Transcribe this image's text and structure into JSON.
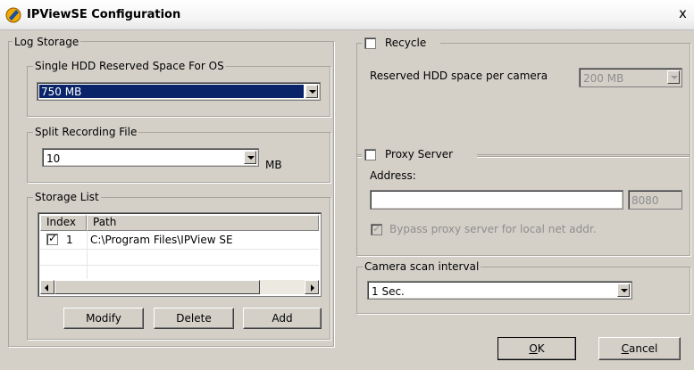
{
  "window": {
    "title": "IPViewSE Configuration",
    "close_glyph": "x"
  },
  "log_storage": {
    "label": "Log Storage",
    "hdd_reserved": {
      "label": "Single HDD Reserved Space For OS",
      "value": "750 MB"
    },
    "split_recording": {
      "label": "Split Recording File",
      "value": "10",
      "unit": "MB"
    },
    "storage_list": {
      "label": "Storage List",
      "columns": [
        "Index",
        "Path"
      ],
      "rows": [
        {
          "checked": true,
          "index": "1",
          "path": "C:\\Program Files\\IPView SE"
        }
      ],
      "buttons": {
        "modify": "Modify",
        "delete": "Delete",
        "add": "Add"
      }
    }
  },
  "recycle": {
    "label": "Recycle",
    "checked": false,
    "reserved_label": "Reserved HDD space per camera",
    "reserved_value": "200 MB"
  },
  "proxy": {
    "label": "Proxy Server",
    "checked": false,
    "address_label": "Address:",
    "address_value": "",
    "port": "8080",
    "bypass_label": "Bypass proxy server for local net addr.",
    "bypass_checked": true
  },
  "camera_scan": {
    "label": "Camera scan interval",
    "value": "1 Sec."
  },
  "footer": {
    "ok_key": "O",
    "ok_rest": "K",
    "cancel_key": "C",
    "cancel_rest": "ancel"
  },
  "colors": {
    "face": "#d4d0c8",
    "selection": "#0a246a",
    "title_bg": "#f3f3f3"
  }
}
